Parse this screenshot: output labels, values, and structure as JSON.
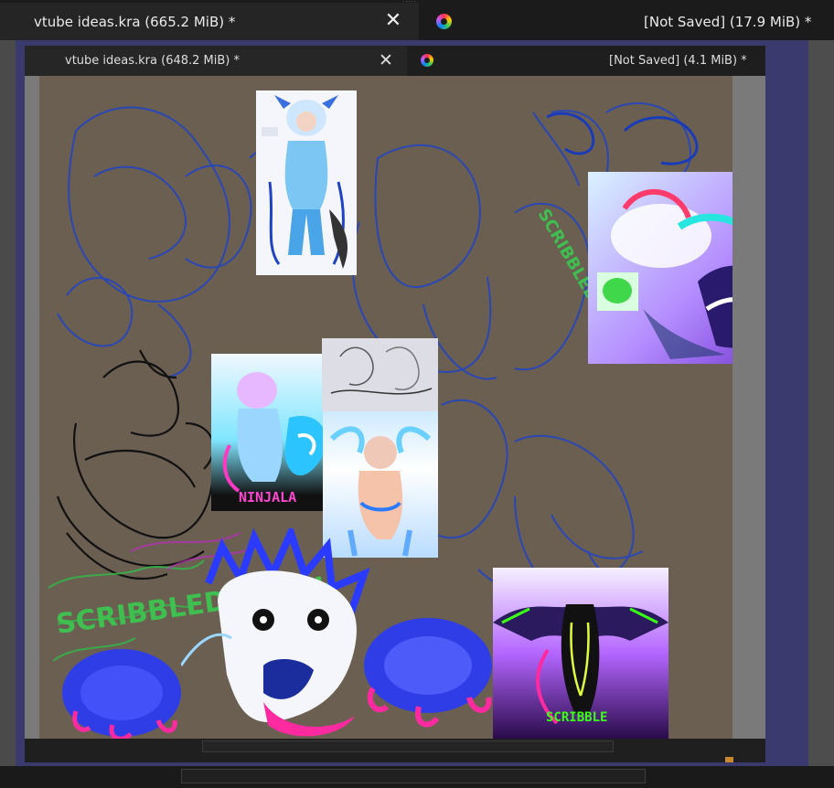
{
  "outer_tabs": [
    {
      "label": "vtube ideas.kra (665.2 MiB) *"
    },
    {
      "label": "[Not Saved]  (17.9 MiB) *"
    }
  ],
  "inner_tabs": [
    {
      "label": "vtube ideas.kra (648.2 MiB) *"
    },
    {
      "label": "[Not Saved]  (4.1 MiB) *"
    }
  ],
  "artwork_text": {
    "scribbled_death_large": "SCRIBBLED DEATH",
    "scribbled_death_small": "SCRIBBLED DEATH",
    "ninjala": "NINJALA",
    "scribble": "SCRIBBLE"
  },
  "colors": {
    "canvas_bg": "#6b5f52",
    "sketch_blue": "#1f43c4",
    "sketch_black": "#111111",
    "scribble_green": "#36b24a",
    "accent_pink": "#ff2aa0"
  }
}
